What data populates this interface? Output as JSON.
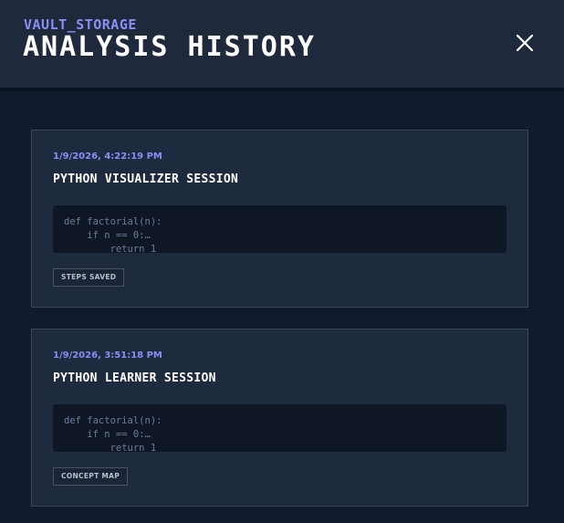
{
  "header": {
    "eyebrow": "VAULT_STORAGE",
    "title": "ANALYSIS HISTORY",
    "close_icon": "close-icon"
  },
  "sessions": [
    {
      "timestamp": "1/9/2026, 4:22:19 PM",
      "title": "PYTHON VISUALIZER SESSION",
      "code_preview": "def factorial(n):\n    if n == 0:…\n        return 1",
      "tag": "STEPS SAVED"
    },
    {
      "timestamp": "1/9/2026, 3:51:18 PM",
      "title": "PYTHON LEARNER SESSION",
      "code_preview": "def factorial(n):\n    if n == 0:…\n        return 1",
      "tag": "CONCEPT MAP"
    }
  ],
  "colors": {
    "accent": "#8b8ff5",
    "background": "#121b2d",
    "panel": "#1e293b",
    "card": "#1e2a3d"
  }
}
